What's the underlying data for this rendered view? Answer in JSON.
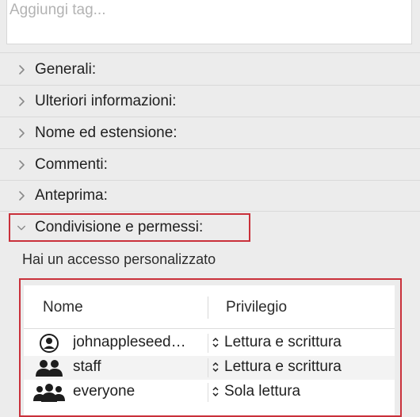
{
  "tags": {
    "placeholder": "Aggiungi tag..."
  },
  "sections": [
    {
      "label": "Generali:",
      "expanded": false
    },
    {
      "label": "Ulteriori informazioni:",
      "expanded": false
    },
    {
      "label": "Nome ed estensione:",
      "expanded": false
    },
    {
      "label": "Commenti:",
      "expanded": false
    },
    {
      "label": "Anteprima:",
      "expanded": false
    },
    {
      "label": "Condivisione e permessi:",
      "expanded": true
    }
  ],
  "sharing": {
    "access_text": "Hai un accesso personalizzato",
    "columns": {
      "name": "Nome",
      "privilege": "Privilegio"
    },
    "rows": [
      {
        "name": "johnappleseed…",
        "privilege": "Lettura e scrittura",
        "icon": "user-circle-icon"
      },
      {
        "name": "staff",
        "privilege": "Lettura e scrittura",
        "icon": "group-icon"
      },
      {
        "name": "everyone",
        "privilege": "Sola lettura",
        "icon": "everyone-icon"
      }
    ]
  },
  "colors": {
    "highlight": "#c9303a",
    "background": "#ececec"
  }
}
